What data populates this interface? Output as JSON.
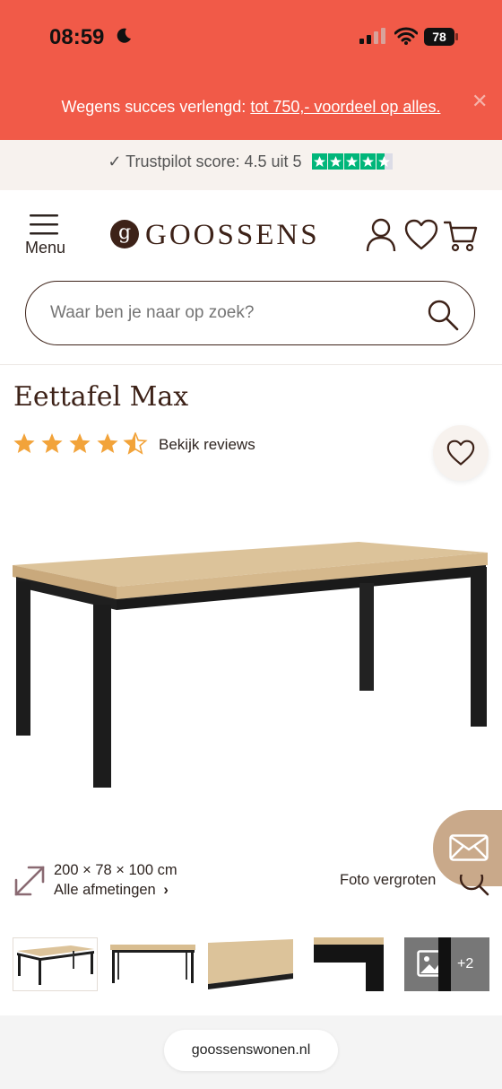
{
  "status": {
    "time": "08:59",
    "battery": "78"
  },
  "promo": {
    "prefix": "Wegens succes verlengd: ",
    "link": "tot 750,- voordeel op alles.",
    "close": "✕"
  },
  "trust": {
    "text": "✓ Trustpilot score: 4.5 uit 5"
  },
  "header": {
    "menu_label": "Menu",
    "logo_mark": "g",
    "logo_text": "GOOSSENS"
  },
  "search": {
    "placeholder": "Waar ben je naar op zoek?"
  },
  "product": {
    "title": "Eettafel Max",
    "rating": 4.5,
    "reviews_label": "Bekijk reviews",
    "dimensions": "200 × 78 × 100 cm",
    "dimensions_link": "Alle afmetingen",
    "zoom_label": "Foto vergroten",
    "more_images": "+2"
  },
  "browser": {
    "url": "goossenswonen.nl"
  },
  "colors": {
    "brand": "#3d2218",
    "promo": "#f15a48",
    "star": "#f2a33a",
    "trustpilot": "#00b67a"
  }
}
